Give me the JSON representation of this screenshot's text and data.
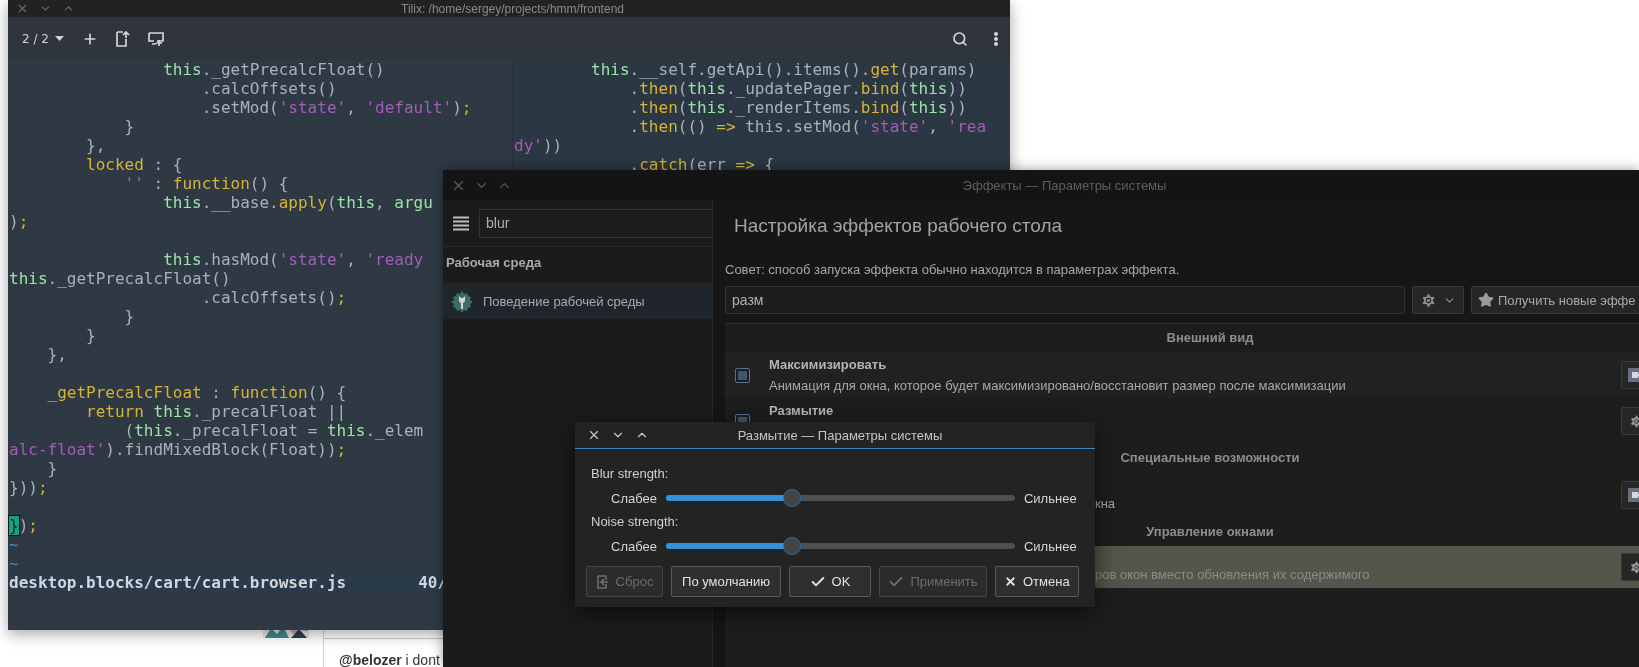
{
  "desktop": {
    "chat_message": "**@belozer** i dont"
  },
  "terminal": {
    "title": "Tilix: /home/sergey/projects/hmm/frontend",
    "session": "2 / 2",
    "left_pane": {
      "lines": [
        {
          "kind": "code",
          "segments": [
            {
              "text": "                this",
              "kind": "self"
            },
            {
              "text": "._getPrecalcFloat()",
              "kind": "plain"
            }
          ]
        },
        {
          "kind": "code",
          "segments": [
            {
              "text": "                    .calcOffsets()",
              "kind": "plain"
            }
          ]
        },
        {
          "kind": "code",
          "segments": [
            {
              "text": "                    .setMod(",
              "kind": "plain"
            },
            {
              "text": "'state'",
              "kind": "string"
            },
            {
              "text": ", ",
              "kind": "plain"
            },
            {
              "text": "'default'",
              "kind": "string"
            },
            {
              "text": ")",
              "kind": "plain"
            },
            {
              "text": ";",
              "kind": "keyword"
            }
          ]
        },
        {
          "kind": "code",
          "segments": [
            {
              "text": "            }",
              "kind": "plain"
            }
          ]
        },
        {
          "kind": "code",
          "segments": [
            {
              "text": "        },",
              "kind": "plain"
            }
          ]
        },
        {
          "kind": "code",
          "segments": [
            {
              "text": "        locked",
              "kind": "keyword"
            },
            {
              "text": " : {",
              "kind": "plain"
            }
          ]
        },
        {
          "kind": "code",
          "segments": [
            {
              "text": "            ''",
              "kind": "string"
            },
            {
              "text": " : ",
              "kind": "plain"
            },
            {
              "text": "function",
              "kind": "keyword"
            },
            {
              "text": "() {",
              "kind": "plain"
            }
          ]
        },
        {
          "kind": "code",
          "segments": [
            {
              "text": "                this",
              "kind": "self"
            },
            {
              "text": ".__base.",
              "kind": "plain"
            },
            {
              "text": "apply",
              "kind": "keyword"
            },
            {
              "text": "(",
              "kind": "plain"
            },
            {
              "text": "this",
              "kind": "self"
            },
            {
              "text": ", ",
              "kind": "plain"
            },
            {
              "text": "argu",
              "kind": "self"
            }
          ]
        },
        {
          "kind": "code",
          "segments": [
            {
              "text": ")",
              "kind": "plain"
            },
            {
              "text": ";",
              "kind": "keyword"
            }
          ]
        },
        {
          "kind": "blank"
        },
        {
          "kind": "code",
          "segments": [
            {
              "text": "                this",
              "kind": "self"
            },
            {
              "text": ".hasMod(",
              "kind": "plain"
            },
            {
              "text": "'state'",
              "kind": "string"
            },
            {
              "text": ", ",
              "kind": "plain"
            },
            {
              "text": "'ready",
              "kind": "string"
            }
          ]
        },
        {
          "kind": "code",
          "segments": [
            {
              "text": "this",
              "kind": "self"
            },
            {
              "text": "._getPrecalcFloat()",
              "kind": "plain"
            }
          ]
        },
        {
          "kind": "code",
          "segments": [
            {
              "text": "                    .calcOffsets()",
              "kind": "plain"
            },
            {
              "text": ";",
              "kind": "keyword"
            }
          ]
        },
        {
          "kind": "code",
          "segments": [
            {
              "text": "            }",
              "kind": "plain"
            }
          ]
        },
        {
          "kind": "code",
          "segments": [
            {
              "text": "        }",
              "kind": "plain"
            }
          ]
        },
        {
          "kind": "code",
          "segments": [
            {
              "text": "    },",
              "kind": "plain"
            }
          ]
        },
        {
          "kind": "blank"
        },
        {
          "kind": "code",
          "segments": [
            {
              "text": "    _getPrecalcFloat",
              "kind": "keyword"
            },
            {
              "text": " : ",
              "kind": "plain"
            },
            {
              "text": "function",
              "kind": "keyword"
            },
            {
              "text": "() {",
              "kind": "plain"
            }
          ]
        },
        {
          "kind": "code",
          "segments": [
            {
              "text": "        return ",
              "kind": "keyword"
            },
            {
              "text": "this",
              "kind": "self"
            },
            {
              "text": "._precalFloat ||",
              "kind": "plain"
            }
          ]
        },
        {
          "kind": "code",
          "segments": [
            {
              "text": "            (",
              "kind": "plain"
            },
            {
              "text": "this",
              "kind": "self"
            },
            {
              "text": "._precalFloat = ",
              "kind": "plain"
            },
            {
              "text": "this",
              "kind": "self"
            },
            {
              "text": "._elem",
              "kind": "plain"
            }
          ]
        },
        {
          "kind": "code",
          "segments": [
            {
              "text": "alc-float'",
              "kind": "string"
            },
            {
              "text": ").findMixedBlock(Float))",
              "kind": "plain"
            },
            {
              "text": ";",
              "kind": "keyword"
            }
          ]
        },
        {
          "kind": "code",
          "segments": [
            {
              "text": "    }",
              "kind": "plain"
            }
          ]
        },
        {
          "kind": "code",
          "segments": [
            {
              "text": "}))",
              "kind": "plain"
            },
            {
              "text": ";",
              "kind": "keyword"
            }
          ]
        },
        {
          "kind": "blank"
        },
        {
          "kind": "code",
          "segments": [
            {
              "text": "}",
              "kind": "cursor"
            },
            {
              "text": ")",
              "kind": "plain"
            },
            {
              "text": ";",
              "kind": "keyword"
            }
          ]
        },
        {
          "kind": "code",
          "segments": [
            {
              "text": "~",
              "kind": "tilde"
            }
          ]
        },
        {
          "kind": "code",
          "segments": [
            {
              "text": "~",
              "kind": "tilde"
            }
          ]
        }
      ],
      "status": {
        "file": "desktop.blocks/cart/cart.browser.js",
        "position": "40/"
      }
    },
    "right_pane": {
      "lines": [
        {
          "kind": "code",
          "segments": [
            {
              "text": "        this",
              "kind": "self"
            },
            {
              "text": ".__self.getApi().items().",
              "kind": "plain"
            },
            {
              "text": "get",
              "kind": "keyword"
            },
            {
              "text": "(params)",
              "kind": "plain"
            }
          ]
        },
        {
          "kind": "code",
          "segments": [
            {
              "text": "            .",
              "kind": "plain"
            },
            {
              "text": "then",
              "kind": "keyword"
            },
            {
              "text": "(",
              "kind": "plain"
            },
            {
              "text": "this",
              "kind": "self"
            },
            {
              "text": "._updatePager.",
              "kind": "plain"
            },
            {
              "text": "bind",
              "kind": "keyword"
            },
            {
              "text": "(",
              "kind": "plain"
            },
            {
              "text": "this",
              "kind": "self"
            },
            {
              "text": "))",
              "kind": "plain"
            }
          ]
        },
        {
          "kind": "code",
          "segments": [
            {
              "text": "            .",
              "kind": "plain"
            },
            {
              "text": "then",
              "kind": "keyword"
            },
            {
              "text": "(",
              "kind": "plain"
            },
            {
              "text": "this",
              "kind": "self"
            },
            {
              "text": "._renderItems.",
              "kind": "plain"
            },
            {
              "text": "bind",
              "kind": "keyword"
            },
            {
              "text": "(",
              "kind": "plain"
            },
            {
              "text": "this",
              "kind": "self"
            },
            {
              "text": "))",
              "kind": "plain"
            }
          ]
        },
        {
          "kind": "code",
          "segments": [
            {
              "text": "            .",
              "kind": "plain"
            },
            {
              "text": "then",
              "kind": "keyword"
            },
            {
              "text": "(() ",
              "kind": "plain"
            },
            {
              "text": "=>",
              "kind": "keyword"
            },
            {
              "text": " this.setMod(",
              "kind": "plain"
            },
            {
              "text": "'state'",
              "kind": "string"
            },
            {
              "text": ", ",
              "kind": "plain"
            },
            {
              "text": "'rea",
              "kind": "string"
            }
          ]
        },
        {
          "kind": "code",
          "segments": [
            {
              "text": "dy'",
              "kind": "string"
            },
            {
              "text": "))",
              "kind": "plain"
            }
          ]
        },
        {
          "kind": "code",
          "segments": [
            {
              "text": "            .",
              "kind": "plain"
            },
            {
              "text": "catch",
              "kind": "keyword"
            },
            {
              "text": "(err ",
              "kind": "plain"
            },
            {
              "text": "=>",
              "kind": "keyword"
            },
            {
              "text": " {",
              "kind": "plain"
            }
          ]
        }
      ]
    }
  },
  "effects_window": {
    "title": "Эффекты — Параметры системы",
    "search": {
      "value": "blur"
    },
    "sidebar": {
      "group": "Рабочая среда",
      "items": [
        {
          "label": "Поведение рабочей среды",
          "selected": true
        }
      ]
    },
    "heading": "Настройка эффектов рабочего стола",
    "hint": "Совет: способ запуска эффекта обычно находится в параметрах эффекта.",
    "filter": {
      "value": "разм"
    },
    "get_new_button": "Получить новые эффе",
    "list": [
      {
        "kind": "header",
        "label": "Внешний вид"
      },
      {
        "kind": "effect",
        "title": "Максимизировать",
        "description": "Анимация для окна, которое будет максимизировано/восстановит размер после максимизации",
        "checked": true,
        "button": {
          "kind": "preview"
        },
        "selected": false
      },
      {
        "kind": "effect",
        "title": "Размытие",
        "checked": true,
        "button": {
          "kind": "configure"
        },
        "selected": false
      },
      {
        "kind": "header",
        "label": "Специальные возможности"
      },
      {
        "kind": "covered",
        "description": "кна",
        "button": {
          "kind": "preview"
        },
        "selected": false
      },
      {
        "kind": "header",
        "label": "Управление окнами"
      },
      {
        "kind": "covered",
        "description": "ров окон вместо обновления их содержимого",
        "button": {
          "kind": "configure"
        },
        "selected": true
      }
    ]
  },
  "dialog": {
    "title": "Размытие — Параметры системы",
    "sliders": [
      {
        "label": "Blur strength:",
        "min_label": "Слабее",
        "max_label": "Сильнее",
        "level": 0.36
      },
      {
        "label": "Noise strength:",
        "min_label": "Слабее",
        "max_label": "Сильнее",
        "level": 0.36
      }
    ],
    "buttons": [
      {
        "label": "Сброс",
        "kind": "reset",
        "disabled": true
      },
      {
        "label": "По умолчанию",
        "kind": "defaults",
        "disabled": false
      },
      {
        "label": "OK",
        "kind": "ok",
        "disabled": false
      },
      {
        "label": "Применить",
        "kind": "apply",
        "disabled": true
      },
      {
        "label": "Отмена",
        "kind": "cancel",
        "disabled": false
      }
    ]
  }
}
